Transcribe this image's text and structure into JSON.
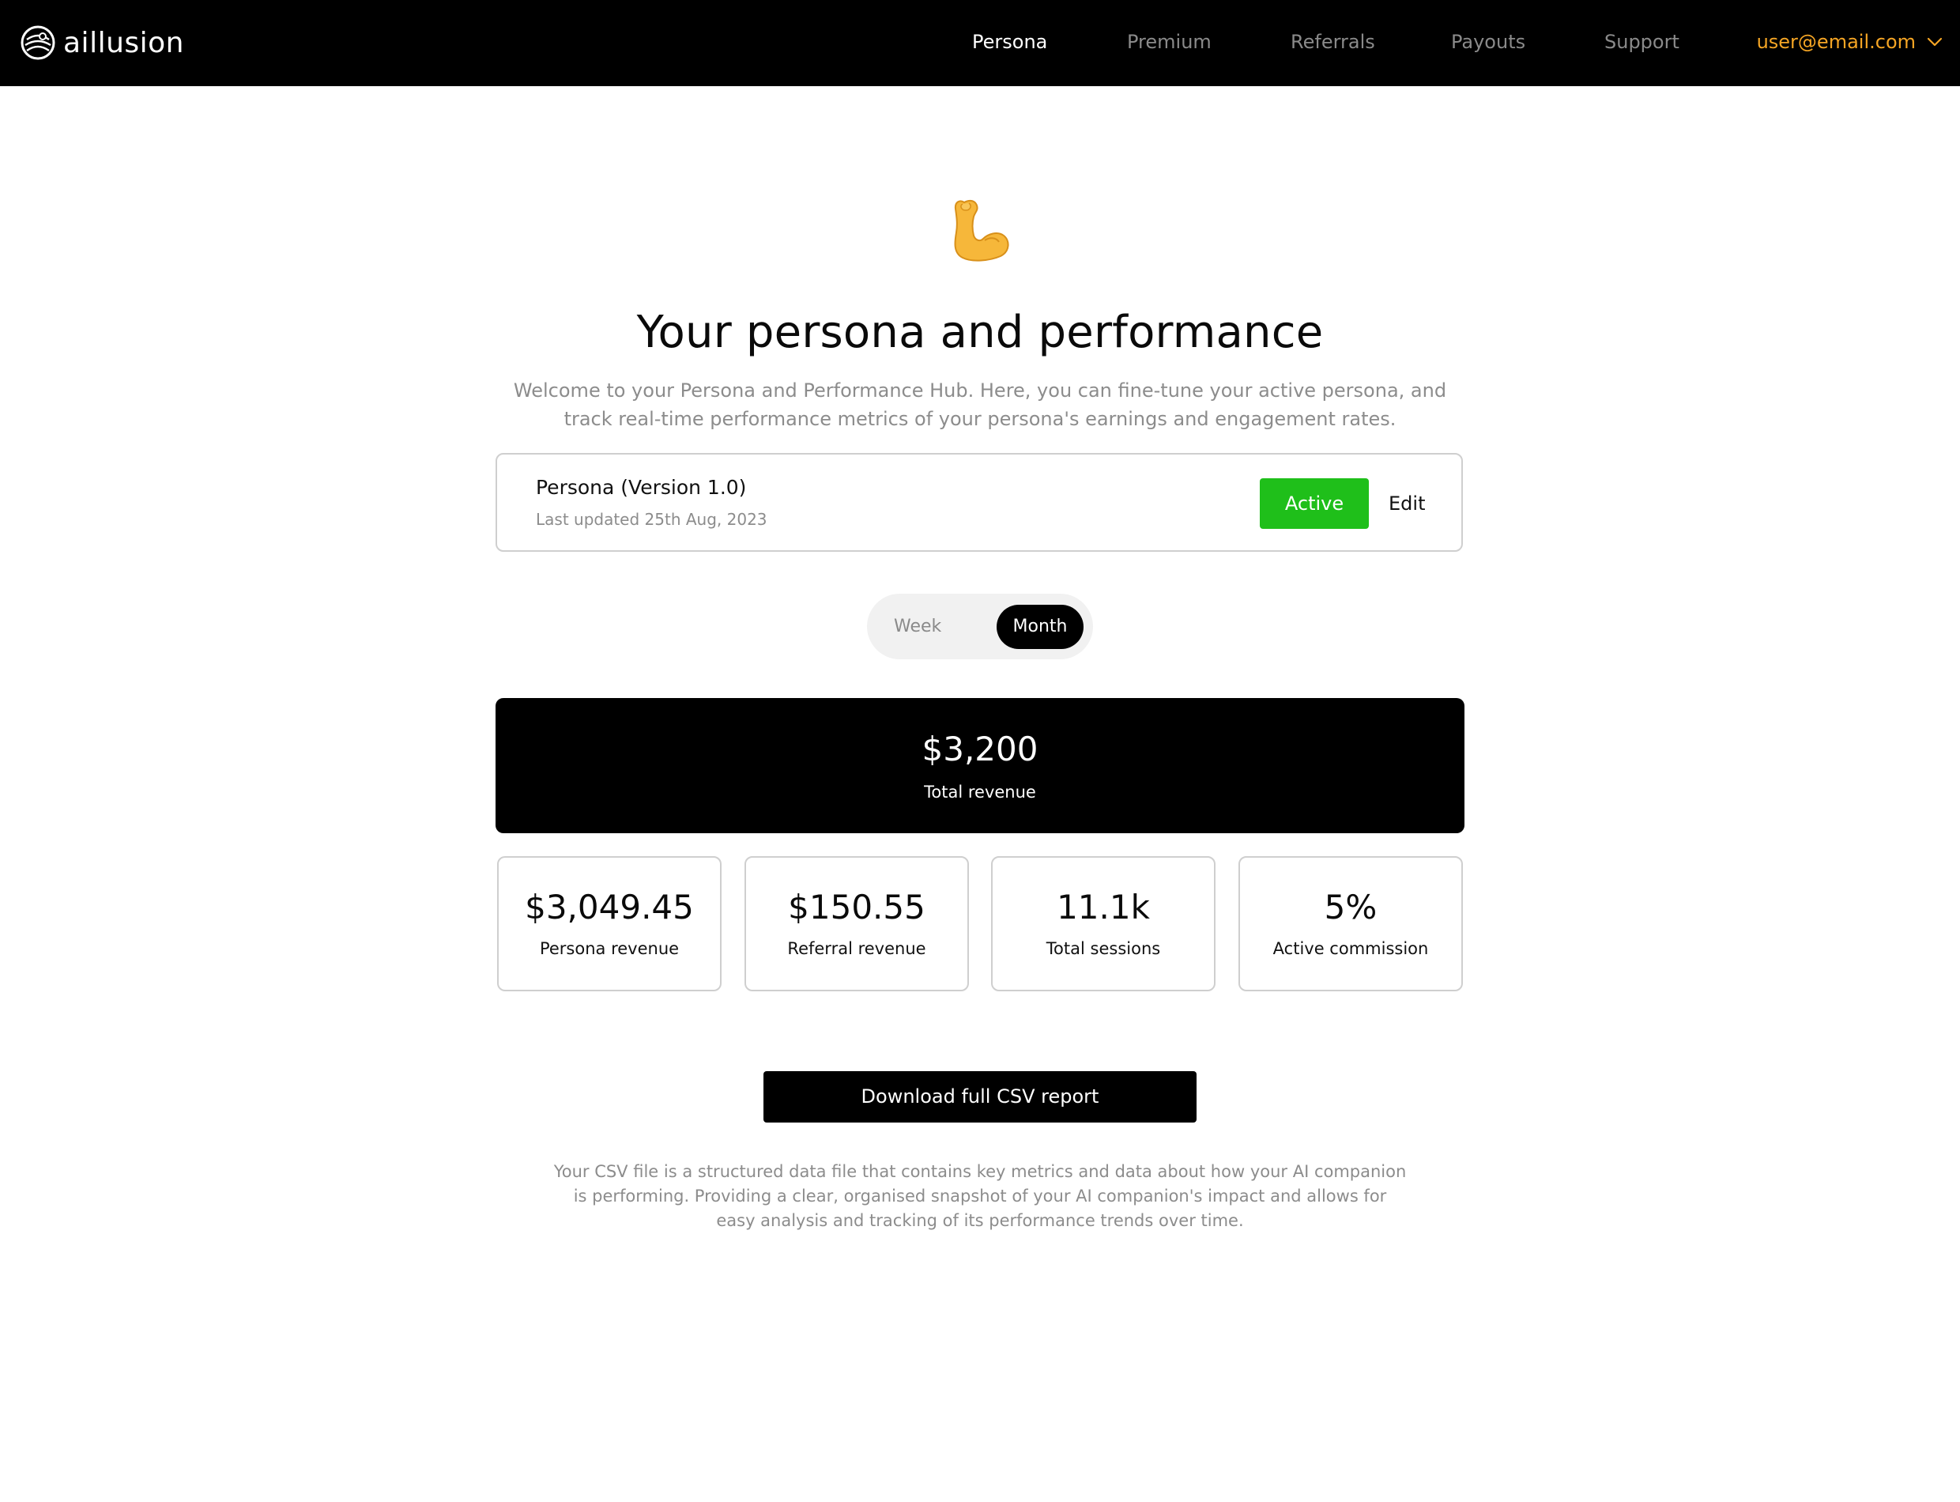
{
  "brand": {
    "name": "aillusion"
  },
  "nav": {
    "items": [
      {
        "label": "Persona",
        "active": true
      },
      {
        "label": "Premium",
        "active": false
      },
      {
        "label": "Referrals",
        "active": false
      },
      {
        "label": "Payouts",
        "active": false
      },
      {
        "label": "Support",
        "active": false
      }
    ],
    "user_email": "user@email.com",
    "user_menu_icon": "chevron-down-icon"
  },
  "hero": {
    "emoji_icon": "flexed-biceps-icon",
    "title": "Your persona and performance",
    "intro": "Welcome to your Persona and Performance Hub. Here, you can fine-tune your active persona, and track real-time performance metrics of your persona's earnings and engagement rates."
  },
  "persona": {
    "name": "Persona (Version 1.0)",
    "last_updated": "Last updated 25th Aug, 2023",
    "status_label": "Active",
    "edit_label": "Edit"
  },
  "period_toggle": {
    "options": [
      "Week",
      "Month"
    ],
    "selected": "Month"
  },
  "total": {
    "value": "$3,200",
    "label": "Total revenue"
  },
  "stats": [
    {
      "value": "$3,049.45",
      "label": "Persona revenue"
    },
    {
      "value": "$150.55",
      "label": "Referral revenue"
    },
    {
      "value": "11.1k",
      "label": "Total sessions"
    },
    {
      "value": "5%",
      "label": "Active commission"
    }
  ],
  "download": {
    "label": "Download full CSV report",
    "note": "Your CSV file is a structured data file that contains key metrics and data about how your AI companion is performing. Providing a clear, organised snapshot of your AI companion's impact and allows for easy analysis and tracking of its performance trends over time."
  },
  "colors": {
    "topbar": "#000000",
    "accent_user": "#f5a524",
    "active_green": "#1fbf1a",
    "muted_text": "#8c8c8c",
    "card_border": "#cfcfcf"
  }
}
